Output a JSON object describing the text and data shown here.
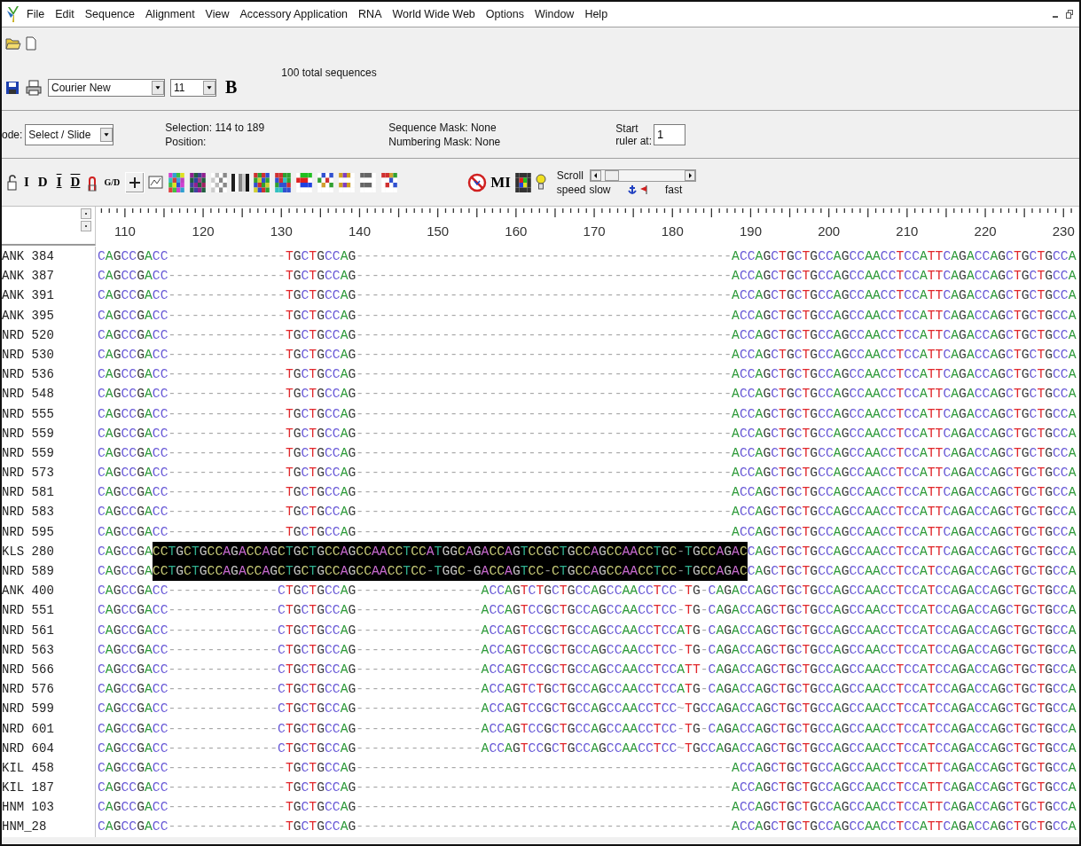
{
  "menu": [
    "File",
    "Edit",
    "Sequence",
    "Alignment",
    "View",
    "Accessory Application",
    "RNA",
    "World Wide Web",
    "Options",
    "Window",
    "Help"
  ],
  "font_select": {
    "value": "Courier New"
  },
  "size_select": {
    "value": "11"
  },
  "bold_button": "B",
  "sequence_count": "100 total sequences",
  "mode": {
    "label": "ode:",
    "value": "Select / Slide"
  },
  "selection": "Selection: 114 to 189",
  "position": "Position:",
  "sequence_mask": "Sequence Mask: None",
  "numbering_mask": "Numbering Mask: None",
  "ruler_start": {
    "label_1": "Start",
    "label_2": "ruler at:",
    "value": "1"
  },
  "tools": [
    {
      "label": "I",
      "barred": false
    },
    {
      "label": "D",
      "barred": false
    },
    {
      "label": "I",
      "barred": true
    },
    {
      "label": "D",
      "barred": true
    }
  ],
  "gd_button": "G/D",
  "mi_button": "MI",
  "scroll": {
    "label_1": "Scroll",
    "label_2": "speed",
    "slow": "slow",
    "fast": "fast"
  },
  "ruler": {
    "labels": [
      "110",
      "120",
      "130",
      "140",
      "150",
      "160",
      "170",
      "180",
      "190",
      "200",
      "210",
      "220",
      "230"
    ]
  },
  "rows": [
    {
      "label": "ANK 384",
      "segments": [
        {
          "text": "CAGCCGACC---------------TGCTGCCAG------------------------------------------------ACCAGCTGCTGCCAGCCAACCTCCATTCAGACCAGCTGCTGCCA",
          "selected": false
        }
      ]
    },
    {
      "label": "ANK 387",
      "segments": [
        {
          "text": "CAGCCGACC---------------TGCTGCCAG------------------------------------------------ACCAGCTGCTGCCAGCCAACCTCCATTCAGACCAGCTGCTGCCA",
          "selected": false
        }
      ]
    },
    {
      "label": "ANK 391",
      "segments": [
        {
          "text": "CAGCCGACC---------------TGCTGCCAG------------------------------------------------ACCAGCTGCTGCCAGCCAACCTCCATTCAGACCAGCTGCTGCCA",
          "selected": false
        }
      ]
    },
    {
      "label": "ANK 395",
      "segments": [
        {
          "text": "CAGCCGACC---------------TGCTGCCAG------------------------------------------------ACCAGCTGCTGCCAGCCAACCTCCATTCAGACCAGCTGCTGCCA",
          "selected": false
        }
      ]
    },
    {
      "label": "NRD 520",
      "segments": [
        {
          "text": "CAGCCGACC---------------TGCTGCCAG------------------------------------------------ACCAGCTGCTGCCAGCCAACCTCCATTCAGACCAGCTGCTGCCA",
          "selected": false
        }
      ]
    },
    {
      "label": "NRD 530",
      "segments": [
        {
          "text": "CAGCCGACC---------------TGCTGCCAG------------------------------------------------ACCAGCTGCTGCCAGCCAACCTCCATTCAGACCAGCTGCTGCCA",
          "selected": false
        }
      ]
    },
    {
      "label": "NRD 536",
      "segments": [
        {
          "text": "CAGCCGACC---------------TGCTGCCAG------------------------------------------------ACCAGCTGCTGCCAGCCAACCTCCATTCAGACCAGCTGCTGCCA",
          "selected": false
        }
      ]
    },
    {
      "label": "NRD 548",
      "segments": [
        {
          "text": "CAGCCGACC---------------TGCTGCCAG------------------------------------------------ACCAGCTGCTGCCAGCCAACCTCCATTCAGACCAGCTGCTGCCA",
          "selected": false
        }
      ]
    },
    {
      "label": "NRD 555",
      "segments": [
        {
          "text": "CAGCCGACC---------------TGCTGCCAG------------------------------------------------ACCAGCTGCTGCCAGCCAACCTCCATTCAGACCAGCTGCTGCCA",
          "selected": false
        }
      ]
    },
    {
      "label": "NRD 559",
      "segments": [
        {
          "text": "CAGCCGACC---------------TGCTGCCAG------------------------------------------------ACCAGCTGCTGCCAGCCAACCTCCATTCAGACCAGCTGCTGCCA",
          "selected": false
        }
      ]
    },
    {
      "label": "NRD 559",
      "segments": [
        {
          "text": "CAGCCGACC---------------TGCTGCCAG------------------------------------------------ACCAGCTGCTGCCAGCCAACCTCCATTCAGACCAGCTGCTGCCA",
          "selected": false
        }
      ]
    },
    {
      "label": "NRD 573",
      "segments": [
        {
          "text": "CAGCCGACC---------------TGCTGCCAG------------------------------------------------ACCAGCTGCTGCCAGCCAACCTCCATTCAGACCAGCTGCTGCCA",
          "selected": false
        }
      ]
    },
    {
      "label": "NRD 581",
      "segments": [
        {
          "text": "CAGCCGACC---------------TGCTGCCAG------------------------------------------------ACCAGCTGCTGCCAGCCAACCTCCATTCAGACCAGCTGCTGCCA",
          "selected": false
        }
      ]
    },
    {
      "label": "NRD 583",
      "segments": [
        {
          "text": "CAGCCGACC---------------TGCTGCCAG------------------------------------------------ACCAGCTGCTGCCAGCCAACCTCCATTCAGACCAGCTGCTGCCA",
          "selected": false
        }
      ]
    },
    {
      "label": "NRD 595",
      "segments": [
        {
          "text": "CAGCCGACC---------------TGCTGCCAG------------------------------------------------ACCAGCTGCTGCCAGCCAACCTCCATTCAGACCAGCTGCTGCCA",
          "selected": false
        }
      ]
    },
    {
      "label": "KLS 280",
      "segments": [
        {
          "text": "CAGCCGA",
          "selected": false
        },
        {
          "text": "CCTGCTGCCAGACCAGCTGCTGCCAGCCAACCTCCATGGCAGACCAGTCCGCTGCCAGCCAACCTGC-TGCCAGAC",
          "selected": true
        },
        {
          "text": "CAGCTGCTGCCAGCCAACCTCCATTCAGACCAGCTGCTGCCA",
          "selected": false
        }
      ]
    },
    {
      "label": "NRD 589",
      "segments": [
        {
          "text": "CAGCCGA",
          "selected": false
        },
        {
          "text": "CCTGCTGCCAGACCAGCTGCTGCCAGCCAACCTCC-TGGC-GACCAGTCC-CTGCCAGCCAACCTCC-TGCCAGAC",
          "selected": true
        },
        {
          "text": "CAGCTGCTGCCAGCCAACCTCCATCCAGACCAGCTGCTGCCA",
          "selected": false
        }
      ]
    },
    {
      "label": "ANK 400",
      "segments": [
        {
          "text": "CAGCCGACC--------------CTGCTGCCAG----------------ACCAGTCTGCTGCCAGCCAACCTCC-TG-CAGACCAGCTGCTGCCAGCCAACCTCCATCCAGACCAGCTGCTGCCA",
          "selected": false
        }
      ]
    },
    {
      "label": "NRD 551",
      "segments": [
        {
          "text": "CAGCCGACC--------------CTGCTGCCAG----------------ACCAGTCCGCTGCCAGCCAACCTCC-TG-CAGACCAGCTGCTGCCAGCCAACCTCCATCCAGACCAGCTGCTGCCA",
          "selected": false
        }
      ]
    },
    {
      "label": "NRD 561",
      "segments": [
        {
          "text": "CAGCCGACC--------------CTGCTGCCAG----------------ACCAGTCCGCTGCCAGCCAACCTCCATG-CAGACCAGCTGCTGCCAGCCAACCTCCATCCAGACCAGCTGCTGCCA",
          "selected": false
        }
      ]
    },
    {
      "label": "NRD 563",
      "segments": [
        {
          "text": "CAGCCGACC--------------CTGCTGCCAG----------------ACCAGTCCGCTGCCAGCCAACCTCC-TG-CAGACCAGCTGCTGCCAGCCAACCTCCATCCAGACCAGCTGCTGCCA",
          "selected": false
        }
      ]
    },
    {
      "label": "NRD 566",
      "segments": [
        {
          "text": "CAGCCGACC--------------CTGCTGCCAG----------------ACCAGTCCGCTGCCAGCCAACCTCCATT-CAGACCAGCTGCTGCCAGCCAACCTCCATCCAGACCAGCTGCTGCCA",
          "selected": false
        }
      ]
    },
    {
      "label": "NRD 576",
      "segments": [
        {
          "text": "CAGCCGACC--------------CTGCTGCCAG----------------ACCAGTCTGCTGCCAGCCAACCTCCATG-CAGACCAGCTGCTGCCAGCCAACCTCCATCCAGACCAGCTGCTGCCA",
          "selected": false
        }
      ]
    },
    {
      "label": "NRD 599",
      "segments": [
        {
          "text": "CAGCCGACC--------------CTGCTGCCAG----------------ACCAGTCCGCTGCCAGCCAACCTCC~TGCCAGACCAGCTGCTGCCAGCCAACCTCCATCCAGACCAGCTGCTGCCA",
          "selected": false
        }
      ]
    },
    {
      "label": "NRD 601",
      "segments": [
        {
          "text": "CAGCCGACC--------------CTGCTGCCAG----------------ACCAGTCCGCTGCCAGCCAACCTCC-TG-CAGACCAGCTGCTGCCAGCCAACCTCCATCCAGACCAGCTGCTGCCA",
          "selected": false
        }
      ]
    },
    {
      "label": "NRD 604",
      "segments": [
        {
          "text": "CAGCCGACC--------------CTGCTGCCAG----------------ACCAGTCCGCTGCCAGCCAACCTCC~TGCCAGACCAGCTGCTGCCAGCCAACCTCCATCCAGACCAGCTGCTGCCA",
          "selected": false
        }
      ]
    },
    {
      "label": "KIL 458",
      "segments": [
        {
          "text": "CAGCCGACC---------------TGCTGCCAG------------------------------------------------ACCAGCTGCTGCCAGCCAACCTCCATTCAGACCAGCTGCTGCCA",
          "selected": false
        }
      ]
    },
    {
      "label": "KIL 187",
      "segments": [
        {
          "text": "CAGCCGACC---------------TGCTGCCAG------------------------------------------------ACCAGCTGCTGCCAGCCAACCTCCATTCAGACCAGCTGCTGCCA",
          "selected": false
        }
      ]
    },
    {
      "label": "HNM 103",
      "segments": [
        {
          "text": "CAGCCGACC---------------TGCTGCCAG------------------------------------------------ACCAGCTGCTGCCAGCCAACCTCCATTCAGACCAGCTGCTGCCA",
          "selected": false
        }
      ]
    },
    {
      "label": "HNM_28",
      "segments": [
        {
          "text": "CAGCCGACC---------------TGCTGCCAG------------------------------------------------ACCAGCTGCTGCCAGCCAACCTCCATTCAGACCAGCTGCTGCCA",
          "selected": false
        }
      ]
    }
  ]
}
